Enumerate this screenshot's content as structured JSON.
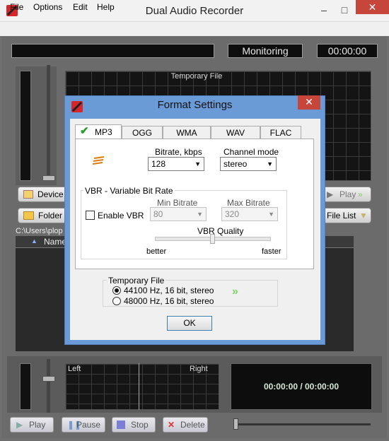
{
  "window": {
    "title": "Dual Audio Recorder",
    "min": "–",
    "max": "□",
    "close": "✕"
  },
  "menu": [
    "File",
    "Options",
    "Edit",
    "Help"
  ],
  "top": {
    "monitor": "Monitoring",
    "time": "00:00:00",
    "scope_label": "Temporary File"
  },
  "buttons": {
    "device": "Device",
    "folder": "Folder",
    "play": "Play",
    "file_list": "File List"
  },
  "path": "C:\\Users\\plop",
  "list": {
    "col_name": "Name"
  },
  "bottom": {
    "left_label": "Left",
    "right_label": "Right",
    "time_display": "00:00:00 / 00:00:00",
    "play": "Play",
    "pause": "Pause",
    "stop": "Stop",
    "delete": "Delete"
  },
  "dialog": {
    "title": "Format Settings",
    "close": "✕",
    "tabs": [
      "MP3",
      "OGG",
      "WMA",
      "WAV",
      "FLAC"
    ],
    "bitrate_label": "Bitrate, kbps",
    "bitrate_value": "128",
    "channel_label": "Channel mode",
    "channel_value": "stereo",
    "vbr_group": "VBR - Variable Bit Rate",
    "enable_vbr": "Enable VBR",
    "min_bitrate_label": "Min Bitrate",
    "min_bitrate_value": "80",
    "max_bitrate_label": "Max Bitrate",
    "max_bitrate_value": "320",
    "vbr_quality_label": "VBR Quality",
    "better": "better",
    "faster": "faster",
    "temp_group": "Temporary File",
    "temp_options": [
      "44100 Hz, 16 bit, stereo",
      "48000 Hz, 16 bit, stereo"
    ],
    "ok": "OK"
  }
}
